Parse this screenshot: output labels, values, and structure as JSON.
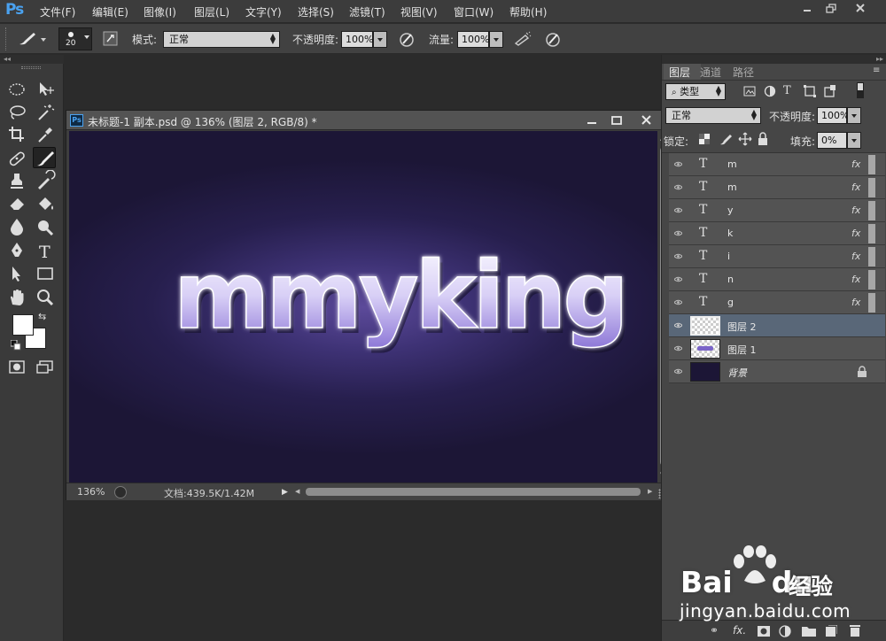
{
  "app": {
    "logo": "Ps"
  },
  "menu": [
    "文件(F)",
    "编辑(E)",
    "图像(I)",
    "图层(L)",
    "文字(Y)",
    "选择(S)",
    "滤镜(T)",
    "视图(V)",
    "窗口(W)",
    "帮助(H)"
  ],
  "options": {
    "brush_size": "20",
    "mode_label": "模式:",
    "mode_value": "正常",
    "opacity_label": "不透明度:",
    "opacity_value": "100%",
    "flow_label": "流量:",
    "flow_value": "100%"
  },
  "document": {
    "title": "未标题-1 副本.psd @ 136% (图层 2, RGB/8) *",
    "canvas_text": "mmyking",
    "zoom": "136%",
    "doc_size": "文档:439.5K/1.42M"
  },
  "layers_panel": {
    "tabs": [
      "图层",
      "通道",
      "路径"
    ],
    "filter_kind": "类型",
    "blend_mode": "正常",
    "opacity_label": "不透明度:",
    "opacity_value": "100%",
    "lock_label": "锁定:",
    "fill_label": "填充:",
    "fill_value": "0%",
    "layers": [
      {
        "name": "m",
        "kind": "text",
        "fx": "fx"
      },
      {
        "name": "m",
        "kind": "text",
        "fx": "fx"
      },
      {
        "name": "y",
        "kind": "text",
        "fx": "fx"
      },
      {
        "name": "k",
        "kind": "text",
        "fx": "fx"
      },
      {
        "name": "i",
        "kind": "text",
        "fx": "fx"
      },
      {
        "name": "n",
        "kind": "text",
        "fx": "fx"
      },
      {
        "name": "g",
        "kind": "text",
        "fx": "fx"
      },
      {
        "name": "图层 2",
        "kind": "pixel",
        "selected": true
      },
      {
        "name": "图层 1",
        "kind": "pixel"
      },
      {
        "name": "背景",
        "kind": "background",
        "locked": true
      }
    ],
    "bottom_fx": "fx."
  },
  "watermark": {
    "brand": "Bai",
    "brand2": "du",
    "product": "经验",
    "url": "jingyan.baidu.com"
  },
  "colors": {
    "accent": "#4aa2f0",
    "selection": "#596778",
    "canvas_bg": "#1c1636",
    "text_glow": "#8e7ad8"
  }
}
